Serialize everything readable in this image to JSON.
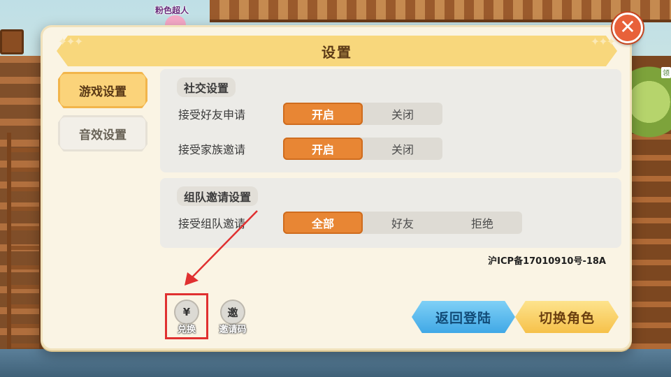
{
  "scene": {
    "player_name": "粉色超人",
    "side_label": "领"
  },
  "modal": {
    "title": "设置",
    "title_deco": "✦✦✦",
    "close_glyph": "✕"
  },
  "tabs": [
    {
      "label": "游戏设置",
      "active": true
    },
    {
      "label": "音效设置",
      "active": false
    }
  ],
  "social": {
    "title": "社交设置",
    "rows": [
      {
        "label": "接受好友申请",
        "options": [
          "开启",
          "关闭"
        ],
        "selected": "开启"
      },
      {
        "label": "接受家族邀请",
        "options": [
          "开启",
          "关闭"
        ],
        "selected": "开启"
      }
    ]
  },
  "team": {
    "title": "组队邀请设置",
    "rows": [
      {
        "label": "接受组队邀请",
        "options": [
          "全部",
          "好友",
          "拒绝"
        ],
        "selected": "全部"
      }
    ]
  },
  "icp": "沪ICP备17010910号-18A",
  "bottom": {
    "redeem": {
      "glyph": "¥",
      "label": "兑换"
    },
    "invite": {
      "glyph": "邀",
      "label": "邀请码"
    },
    "back_login": "返回登陆",
    "switch_role": "切换角色"
  },
  "colors": {
    "accent_orange": "#e88634",
    "title_yellow": "#f8d77c",
    "highlight_red": "#e03030"
  }
}
